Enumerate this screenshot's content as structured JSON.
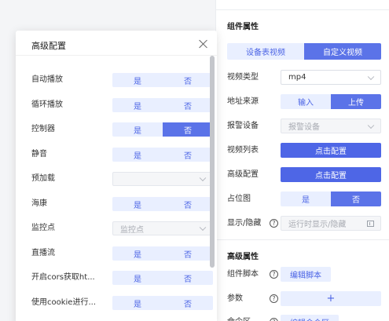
{
  "panel": {
    "section_component": "组件属性",
    "video_source_tabs": [
      {
        "label": "设备表视频",
        "selected": false
      },
      {
        "label": "自定义视频",
        "selected": true
      }
    ],
    "video_type": {
      "label": "视频类型",
      "value": "mp4"
    },
    "address_source": {
      "label": "地址来源",
      "options": [
        {
          "label": "输入",
          "selected": false
        },
        {
          "label": "上传",
          "selected": true
        }
      ]
    },
    "alarm_device": {
      "label": "报警设备",
      "placeholder": "报警设备"
    },
    "video_list": {
      "label": "视频列表",
      "button": "点击配置"
    },
    "advanced_config": {
      "label": "高级配置",
      "button": "点击配置"
    },
    "placeholder_image": {
      "label": "占位图",
      "options": [
        {
          "label": "是",
          "selected": false
        },
        {
          "label": "否",
          "selected": true
        }
      ]
    },
    "show_hide": {
      "label": "显示/隐藏",
      "help": "?",
      "placeholder": "运行时显示/隐藏"
    },
    "section_advanced": "高级属性",
    "component_script": {
      "label": "组件脚本",
      "help": "?",
      "button": "编辑脚本"
    },
    "params": {
      "label": "参数",
      "help": "?",
      "button": "+"
    },
    "partial_row": {
      "label": "命令区",
      "button": "编辑命令区"
    }
  },
  "dialog": {
    "title": "高级配置",
    "rows": [
      {
        "label": "自动播放",
        "kind": "toggle",
        "yes": "是",
        "no": "否",
        "selected": "none"
      },
      {
        "label": "循环播放",
        "kind": "toggle",
        "yes": "是",
        "no": "否",
        "selected": "none"
      },
      {
        "label": "控制器",
        "kind": "toggle",
        "yes": "是",
        "no": "否",
        "selected": "no"
      },
      {
        "label": "静音",
        "kind": "toggle",
        "yes": "是",
        "no": "否",
        "selected": "none"
      },
      {
        "label": "预加载",
        "kind": "select",
        "value": ""
      },
      {
        "label": "海康",
        "kind": "toggle",
        "yes": "是",
        "no": "否",
        "selected": "none"
      },
      {
        "label": "监控点",
        "kind": "select",
        "value": "监控点"
      },
      {
        "label": "直播流",
        "kind": "toggle",
        "yes": "是",
        "no": "否",
        "selected": "none"
      },
      {
        "label": "开启cors获取ht...",
        "kind": "toggle",
        "yes": "是",
        "no": "否",
        "selected": "none"
      },
      {
        "label": "使用cookie进行...",
        "kind": "toggle",
        "yes": "是",
        "no": "否",
        "selected": "none"
      }
    ]
  },
  "colors": {
    "primary": "#4e66e6",
    "segment_on": "#5b73e8",
    "segment_off_bg": "#e9efff",
    "segment_off_text": "#4b64e5"
  }
}
